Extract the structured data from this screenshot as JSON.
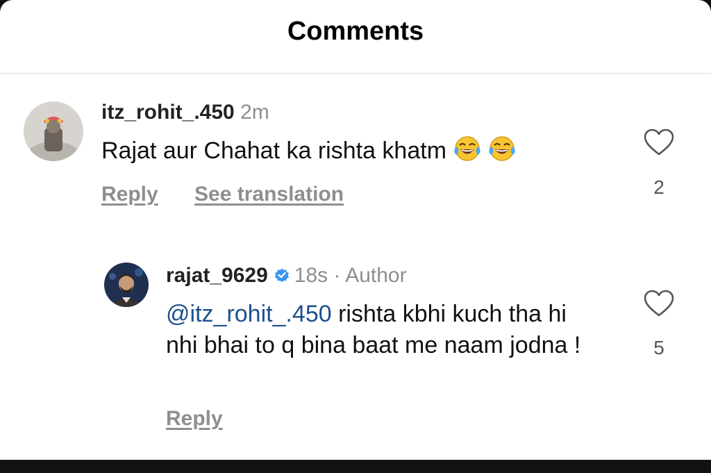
{
  "header": {
    "title": "Comments"
  },
  "comments": [
    {
      "username": "itz_rohit_.450",
      "time": "2m",
      "text": "Rajat aur Chahat ka rishta khatm",
      "emojis": [
        "face-with-tears-of-joy-icon",
        "face-with-tears-of-joy-icon"
      ],
      "reply_label": "Reply",
      "translate_label": "See translation",
      "likes": "2"
    }
  ],
  "reply": {
    "username": "rajat_9629",
    "verified": true,
    "time": "18s",
    "separator": "·",
    "role": "Author",
    "mention": "@itz_rohit_.450",
    "text": " rishta kbhi kuch tha hi nhi bhai to q bina baat me naam jodna !",
    "reply_label": "Reply",
    "likes": "5"
  },
  "colors": {
    "accent_mention": "#1c4f8e",
    "muted": "#8e8e8e",
    "verified": "#3897f0"
  }
}
